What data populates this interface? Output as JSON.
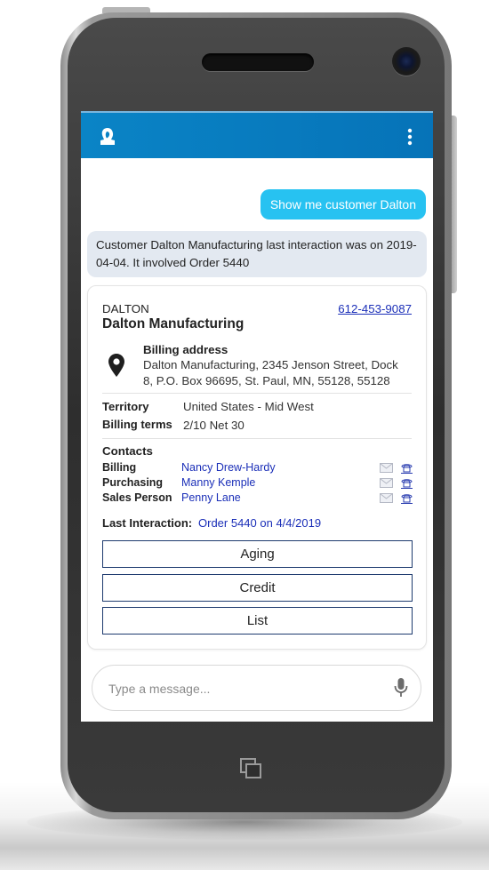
{
  "chat": {
    "user_message": "Show me customer Dalton",
    "bot_message": "Customer Dalton Manufacturing last interaction was on 2019-04-04. It involved Order 5440"
  },
  "customer": {
    "code": "DALTON",
    "name": "Dalton Manufacturing",
    "phone": "612-453-9087",
    "billing_address_label": "Billing address",
    "billing_address": "Dalton Manufacturing, 2345 Jenson Street, Dock 8, P.O. Box 96695, St. Paul, MN, 55128, 55128",
    "territory_label": "Territory",
    "territory": "United States - Mid West",
    "billing_terms_label": "Billing terms",
    "billing_terms": "2/10 Net 30",
    "contacts_label": "Contacts",
    "contacts": [
      {
        "role": "Billing",
        "name": "Nancy Drew-Hardy"
      },
      {
        "role": "Purchasing",
        "name": "Manny Kemple"
      },
      {
        "role": "Sales Person",
        "name": "Penny Lane"
      }
    ],
    "last_interaction_label": "Last Interaction:",
    "last_interaction": "Order 5440 on 4/4/2019"
  },
  "actions": [
    "Aging",
    "Credit",
    "List"
  ],
  "input": {
    "placeholder": "Type a message..."
  },
  "colors": {
    "app_bar": "#0a84c6",
    "user_bubble": "#27c2f1",
    "bot_bubble": "#e3e9f1",
    "link": "#1b2fb8",
    "button_border": "#1d3a6e"
  },
  "icons": [
    "app-logo-icon",
    "more-vert-icon",
    "map-pin-icon",
    "mail-icon",
    "phone-icon",
    "mic-icon",
    "home-button-icon"
  ]
}
